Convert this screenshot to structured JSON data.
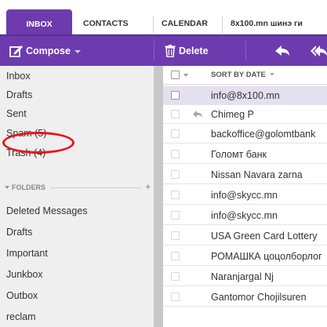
{
  "tabs": [
    {
      "label": "INBOX"
    },
    {
      "label": "CONTACTS"
    },
    {
      "label": "CALENDAR"
    },
    {
      "label": "8x100.mn шинэ ги"
    }
  ],
  "toolbar": {
    "compose_label": "Compose",
    "delete_label": "Delete"
  },
  "folders": {
    "system": [
      {
        "label": "Inbox"
      },
      {
        "label": "Drafts"
      },
      {
        "label": "Sent"
      },
      {
        "label": "Spam (5)"
      },
      {
        "label": "Trash (4)"
      }
    ],
    "header": "FOLDERS",
    "custom": [
      {
        "label": "Deleted Messages"
      },
      {
        "label": "Drafts"
      },
      {
        "label": "Important"
      },
      {
        "label": "Junkbox"
      },
      {
        "label": "Outbox"
      },
      {
        "label": "reclam"
      }
    ]
  },
  "messages": {
    "sort_label": "SORT BY DATE",
    "rows": [
      {
        "sender": "info@8x100.mn"
      },
      {
        "sender": "Chimeg P"
      },
      {
        "sender": "backoffice@golomtbank"
      },
      {
        "sender": "Голомт банк"
      },
      {
        "sender": "Nissan Navara zarna"
      },
      {
        "sender": "info@skycc.mn"
      },
      {
        "sender": "info@skycc.mn"
      },
      {
        "sender": "USA Green Card Lottery"
      },
      {
        "sender": "РОМАШКА цоцолборлог"
      },
      {
        "sender": "Naranjargal Nj"
      },
      {
        "sender": "Gantomor Chojilsuren"
      }
    ]
  },
  "colors": {
    "accent": "#6d3bae",
    "highlight_ring": "#e8141c",
    "selected_row": "#e4e0ef"
  }
}
